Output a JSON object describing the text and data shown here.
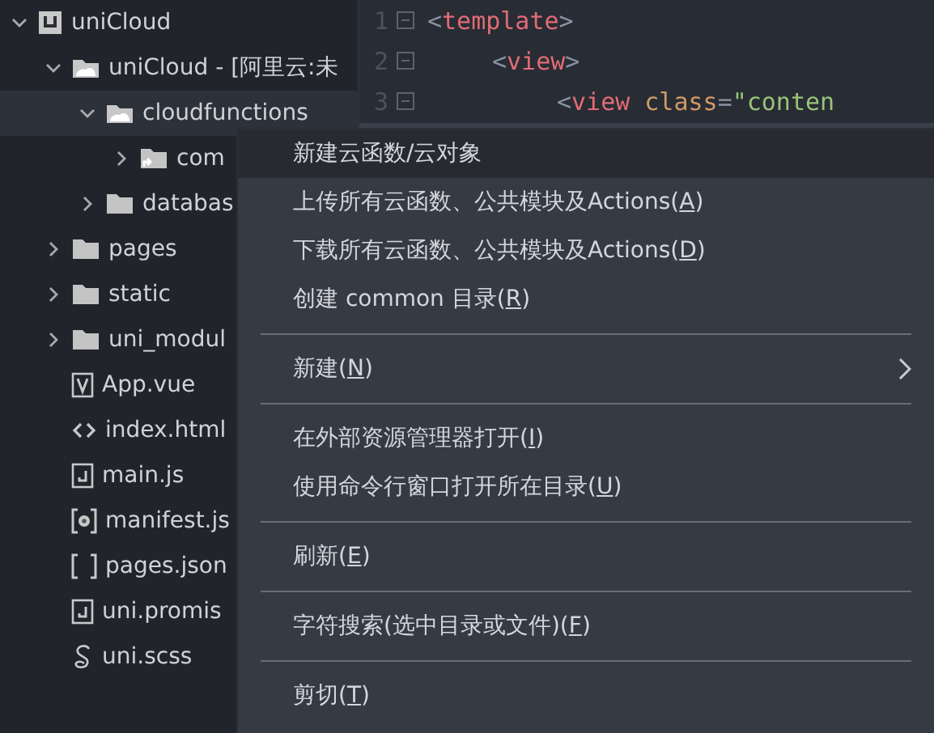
{
  "tree": [
    {
      "label": "uniCloud",
      "kind": "project",
      "expanded": true,
      "selected": false,
      "children": [
        {
          "label": "uniCloud - [阿里云:未",
          "kind": "cloud",
          "expanded": true,
          "selected": false,
          "children": [
            {
              "label": "cloudfunctions",
              "kind": "cloud",
              "expanded": true,
              "selected": true,
              "children": [
                {
                  "label": "com",
                  "kind": "linked",
                  "expanded": false,
                  "selected": false
                }
              ]
            },
            {
              "label": "databas",
              "kind": "folder",
              "expanded": false,
              "selected": false
            }
          ]
        },
        {
          "label": "pages",
          "kind": "folder",
          "expanded": false,
          "selected": false
        },
        {
          "label": "static",
          "kind": "folder",
          "expanded": false,
          "selected": false
        },
        {
          "label": "uni_modul",
          "kind": "folder",
          "expanded": false,
          "selected": false
        },
        {
          "label": "App.vue",
          "kind": "vue",
          "selected": false
        },
        {
          "label": "index.html",
          "kind": "html",
          "selected": false
        },
        {
          "label": "main.js",
          "kind": "js",
          "selected": false
        },
        {
          "label": "manifest.js",
          "kind": "manifest",
          "selected": false
        },
        {
          "label": "pages.json",
          "kind": "json",
          "selected": false
        },
        {
          "label": "uni.promis",
          "kind": "js",
          "selected": false
        },
        {
          "label": "uni.scss",
          "kind": "scss",
          "selected": false
        }
      ]
    }
  ],
  "editor": {
    "lines": [
      {
        "number": "1",
        "tokens": [
          {
            "kind": "punct",
            "text": "<"
          },
          {
            "kind": "tag",
            "text": "template"
          },
          {
            "kind": "punct",
            "text": ">"
          }
        ],
        "children": [
          {
            "number": "2",
            "tokens": [
              {
                "kind": "punct",
                "text": "<"
              },
              {
                "kind": "tag",
                "text": "view"
              },
              {
                "kind": "punct",
                "text": ">"
              }
            ],
            "children": [
              {
                "number": "3",
                "tokens": [
                  {
                    "kind": "punct",
                    "text": "<"
                  },
                  {
                    "kind": "tag",
                    "text": "view"
                  },
                  {
                    "kind": "attr",
                    "text": "class"
                  },
                  {
                    "kind": "punct",
                    "text": "="
                  },
                  {
                    "kind": "string",
                    "text": "\"conten"
                  }
                ]
              }
            ]
          }
        ]
      }
    ]
  },
  "context_menu": {
    "items": [
      {
        "kind": "item",
        "text": "新建云函数/云对象",
        "highlighted": true
      },
      {
        "kind": "item",
        "text": "上传所有云函数、公共模块及Actions(",
        "key": "A",
        "end": ")",
        "highlighted": false
      },
      {
        "kind": "item",
        "text": "下载所有云函数、公共模块及Actions(",
        "key": "D",
        "end": ")",
        "highlighted": false
      },
      {
        "kind": "item",
        "text": "创建 common 目录(",
        "key": "R",
        "end": ")",
        "highlighted": false
      },
      {
        "kind": "separator"
      },
      {
        "kind": "item",
        "text": "新建(",
        "key": "N",
        "end": ")",
        "highlighted": false,
        "submenu": true
      },
      {
        "kind": "separator"
      },
      {
        "kind": "item",
        "text": "在外部资源管理器打开(",
        "key": "I",
        "end": ")",
        "highlighted": false
      },
      {
        "kind": "item",
        "text": "使用命令行窗口打开所在目录(",
        "key": "U",
        "end": ")",
        "highlighted": false
      },
      {
        "kind": "separator"
      },
      {
        "kind": "item",
        "text": "刷新(",
        "key": "E",
        "end": ")",
        "highlighted": false
      },
      {
        "kind": "separator"
      },
      {
        "kind": "item",
        "text": "字符搜索(选中目录或文件)(",
        "key": "F",
        "end": ")",
        "highlighted": false
      },
      {
        "kind": "separator"
      },
      {
        "kind": "item",
        "text": "剪切(",
        "key": "T",
        "end": ")",
        "highlighted": false
      }
    ]
  }
}
